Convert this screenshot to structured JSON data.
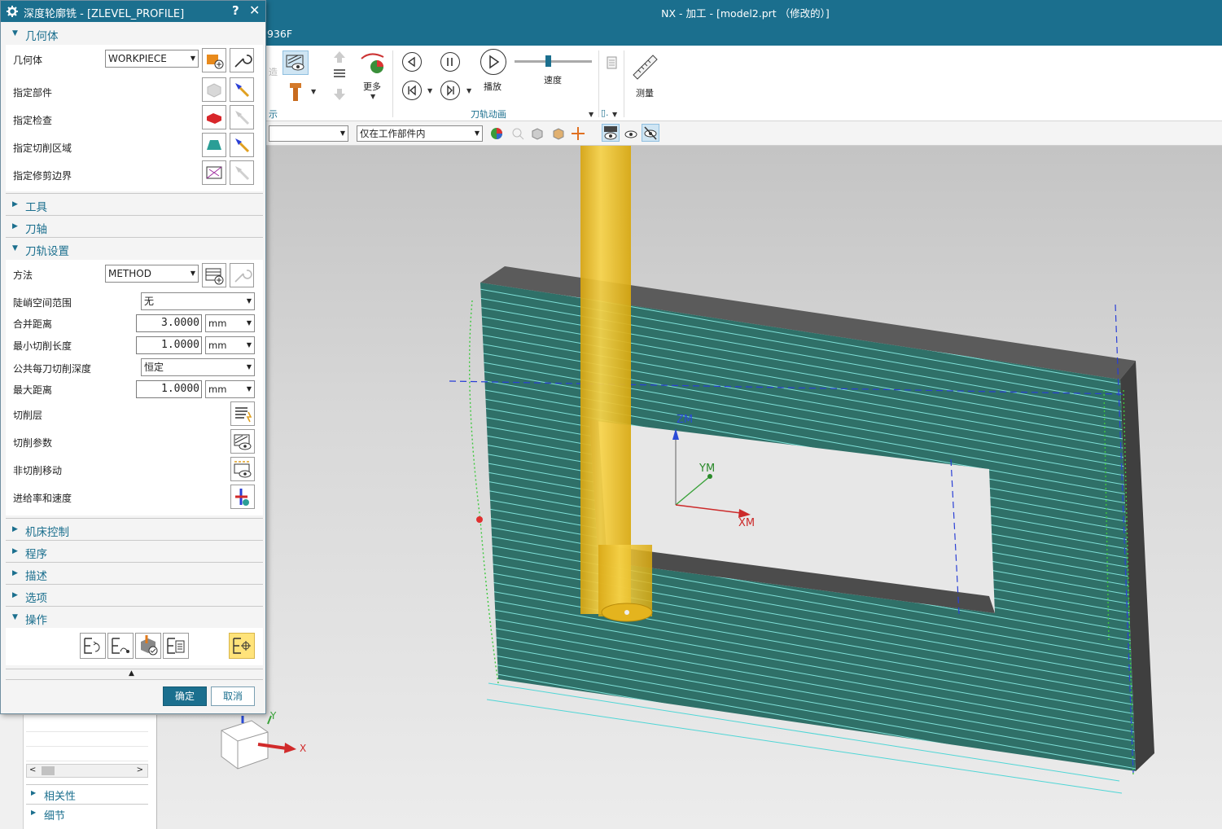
{
  "app": {
    "window_title": "NX - 加工 - [model2.prt （修改的）]",
    "tab_fragment": "936F"
  },
  "ribbon": {
    "more_label": "更多",
    "play_label": "播放",
    "speed_label": "速度",
    "measure_label": "测量",
    "group_fragment": "示",
    "group_toolpath_animation": "刀轨动画",
    "group_short": "▯.",
    "ghost_label": "造"
  },
  "filterbar": {
    "scope_select": "仅在工作部件内",
    "left_select": ""
  },
  "dialog": {
    "title": "深度轮廓铣 - [ZLEVEL_PROFILE]",
    "help": "?",
    "close": "✕",
    "sections": {
      "geometry": "几何体",
      "tool": "工具",
      "axis": "刀轴",
      "path_settings": "刀轨设置",
      "machine_control": "机床控制",
      "program": "程序",
      "description": "描述",
      "options": "选项",
      "actions": "操作"
    },
    "geometry": {
      "geometry_label": "几何体",
      "geometry_value": "WORKPIECE",
      "specify_part": "指定部件",
      "specify_check": "指定检查",
      "specify_cut_area": "指定切削区域",
      "specify_trim": "指定修剪边界"
    },
    "path": {
      "method_label": "方法",
      "method_value": "METHOD",
      "steep_label": "陡峭空间范围",
      "steep_value": "无",
      "merge_label": "合并距离",
      "merge_value": "3.0000",
      "merge_unit": "mm",
      "min_cut_label": "最小切削长度",
      "min_cut_value": "1.0000",
      "min_cut_unit": "mm",
      "depth_label": "公共每刀切削深度",
      "depth_value": "恒定",
      "max_dist_label": "最大距离",
      "max_dist_value": "1.0000",
      "max_dist_unit": "mm",
      "cut_levels": "切削层",
      "cut_params": "切削参数",
      "non_cut": "非切削移动",
      "feeds": "进给率和速度"
    },
    "ok": "确定",
    "cancel": "取消"
  },
  "navigator": {
    "relevance": "相关性",
    "details": "细节"
  },
  "viewport": {
    "axis_zm": "ZM",
    "axis_ym": "YM",
    "axis_xm": "XM",
    "triad_y": "Y",
    "triad_x": "X"
  },
  "colors": {
    "title_blue": "#1b6f8e",
    "tool_yellow": "#f2c12e",
    "path_cyan": "#4fd6d6",
    "path_green": "#3ec83e",
    "part_gray": "#6c6c6c"
  }
}
